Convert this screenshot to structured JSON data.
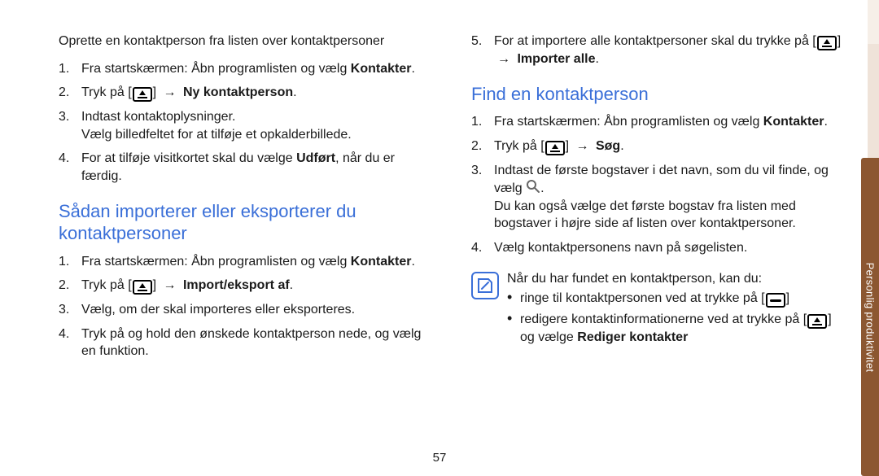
{
  "left": {
    "create_intro": "Oprette en kontaktperson fra listen over kontaktpersoner",
    "create_steps": [
      {
        "pre": "Fra startskærmen: Åbn programlisten og vælg ",
        "bold": "Kontakter",
        "post": "."
      },
      {
        "pre": "Tryk på [",
        "icon": "menu",
        "mid": "] ",
        "arrow": "→ ",
        "bold": "Ny kontaktperson",
        "post": "."
      },
      {
        "pre": "Indtast kontaktoplysninger.",
        "sub": "Vælg billedfeltet for at tilføje et opkalderbillede."
      },
      {
        "pre": "For at tilføje visitkortet skal du vælge ",
        "bold": "Udført",
        "post": ", når du er færdig."
      }
    ],
    "import_heading": "Sådan importerer eller eksporterer du kontaktpersoner",
    "import_steps": [
      {
        "pre": "Fra startskærmen: Åbn programlisten og vælg ",
        "bold": "Kontakter",
        "post": "."
      },
      {
        "pre": "Tryk på [",
        "icon": "menu",
        "mid": "] ",
        "arrow": "→ ",
        "bold": "Import/eksport af",
        "post": "."
      },
      {
        "pre": "Vælg, om der skal importeres eller eksporteres."
      },
      {
        "pre": "Tryk på og hold den ønskede kontaktperson nede, og vælg en funktion."
      }
    ]
  },
  "right": {
    "continue_start": 5,
    "continue_steps": [
      {
        "pre": "For at importere alle kontaktpersoner skal du trykke på [",
        "icon": "menu",
        "mid": "] ",
        "arrow": "→ ",
        "bold": "Importer alle",
        "post": "."
      }
    ],
    "find_heading": "Find en kontaktperson",
    "find_steps": [
      {
        "pre": "Fra startskærmen: Åbn programlisten og vælg ",
        "bold": "Kontakter",
        "post": "."
      },
      {
        "pre": "Tryk på [",
        "icon": "menu",
        "mid": "] ",
        "arrow": "→ ",
        "bold": "Søg",
        "post": "."
      },
      {
        "pre": "Indtast de første bogstaver i det navn, som du vil finde, og vælg ",
        "searchicon": true,
        "post2": ".",
        "sub": "Du kan også vælge det første bogstav fra listen med bogstaver i højre side af listen over kontaktpersoner."
      },
      {
        "pre": "Vælg kontaktpersonens navn på søgelisten."
      }
    ],
    "note_intro": "Når du har fundet en kontaktperson, kan du:",
    "note_items": [
      {
        "pre": "ringe til kontaktpersonen ved at trykke på [",
        "icon": "call",
        "mid": "]"
      },
      {
        "pre": "redigere kontaktinformationerne ved at trykke på [",
        "icon": "menu",
        "mid": "] og vælge ",
        "bold": "Rediger kontakter"
      }
    ]
  },
  "sidebar_label": "Personlig produktivitet",
  "page_number": "57"
}
